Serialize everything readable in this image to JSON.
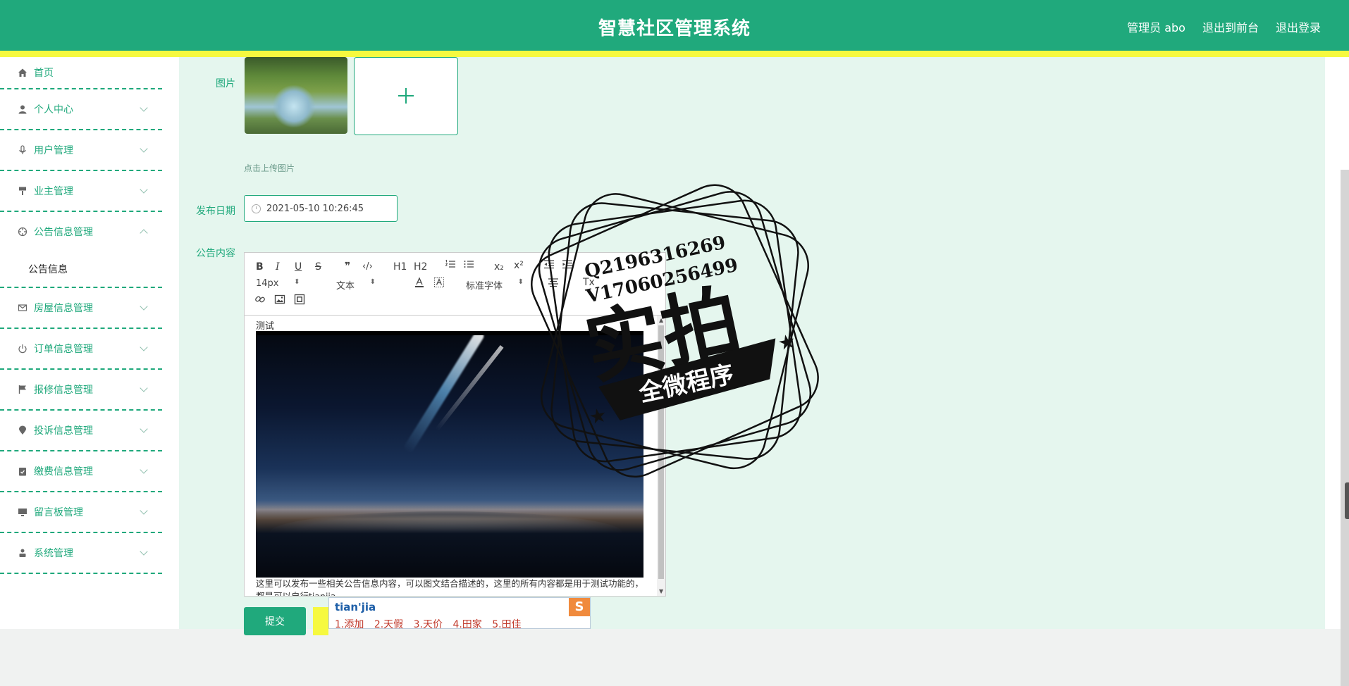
{
  "header": {
    "title": "智慧社区管理系统",
    "user": "管理员 abo",
    "to_front": "退出到前台",
    "logout": "退出登录"
  },
  "sidebar": {
    "items": [
      {
        "label": "首页"
      },
      {
        "label": "个人中心"
      },
      {
        "label": "用户管理"
      },
      {
        "label": "业主管理"
      },
      {
        "label": "公告信息管理",
        "sub": "公告信息"
      },
      {
        "label": "房屋信息管理"
      },
      {
        "label": "订单信息管理"
      },
      {
        "label": "报修信息管理"
      },
      {
        "label": "投诉信息管理"
      },
      {
        "label": "缴费信息管理"
      },
      {
        "label": "留言板管理"
      },
      {
        "label": "系统管理"
      }
    ]
  },
  "form": {
    "image_label": "图片",
    "upload_hint": "点击上传图片",
    "date_label": "发布日期",
    "date_value": "2021-05-10 10:26:45",
    "content_label": "公告内容",
    "submit": "提交"
  },
  "editor": {
    "toolbar": {
      "bold": "B",
      "italic": "I",
      "underline": "U",
      "strike": "S",
      "quote": "❞",
      "code": "‹/›",
      "h1": "H1",
      "h2": "H2",
      "sub": "x₂",
      "sup": "x²",
      "clear": "Tx",
      "size": "14px",
      "header": "文本",
      "font": "标准字体"
    },
    "text_top": "测试",
    "text_bottom": "这里可以发布一些相关公告信息内容，可以图文结合描述的，这里的所有内容都是用于测试功能的，都是可以自行tianjia"
  },
  "ime": {
    "composition": "tian'jia",
    "candidates": [
      "1.添加",
      "2.天假",
      "3.天价",
      "4.田家",
      "5.田佳"
    ],
    "logo": "S"
  },
  "stamp": {
    "line1": "Q2196316269",
    "line2": "V17060256499",
    "big": "实拍",
    "ribbon": "全微程序"
  }
}
